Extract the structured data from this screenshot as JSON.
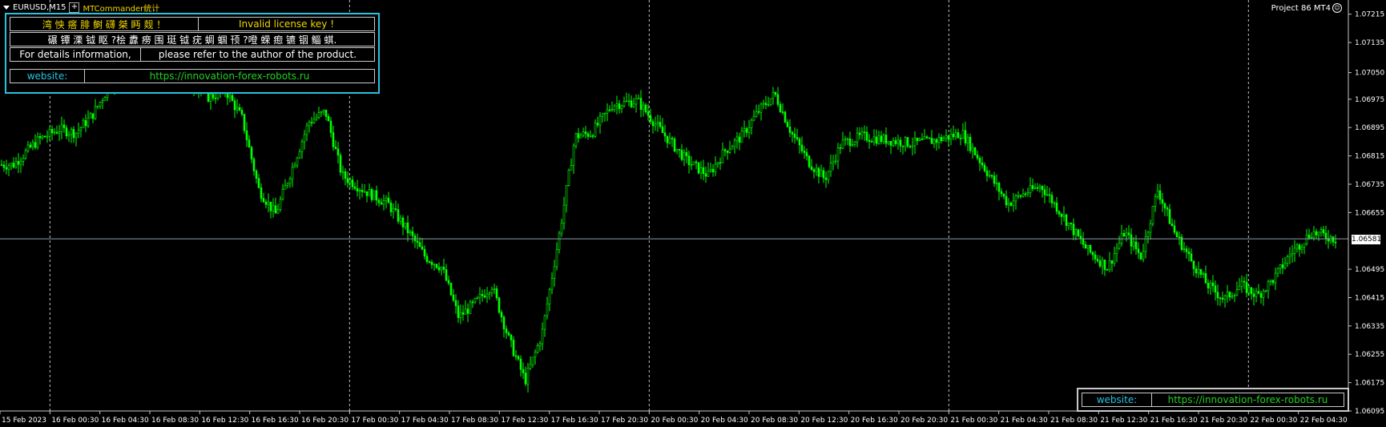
{
  "symbol": "EURUSD,M15",
  "plus_label": "+",
  "indicator_name": "MTCommander统计",
  "project_label": "Project 86 MT4",
  "smiley_icon": "smiley-icon",
  "panel": {
    "row1": {
      "garbled": "湾 怏 瘩       腓 鲥 礴 桀 眄       觌       ！",
      "message": "Invalid license key !"
    },
    "row2": {
      "text": "碾      镡 溧 钺 眍 ?桧 纛 痨 围 珽  钺 疣 蜩 蝈 顸  ?噔 蝾 瘛  镳 铟 鲻 蜞."
    },
    "row3": {
      "left": "For details information,",
      "right": "please refer to the author of the product."
    },
    "row4": {
      "label": "website:",
      "url": "https://innovation-forex-robots.ru"
    }
  },
  "website_box": {
    "label": "website:",
    "url": "https://innovation-forex-robots.ru"
  },
  "current_price": "1.06581",
  "colors": {
    "candle": "#00ff00",
    "grid": "#c0c0c0",
    "price_line": "#8a9aa8",
    "panel_border": "#27c2e0"
  },
  "price_axis": [
    "1.07215",
    "1.07135",
    "1.07050",
    "1.06975",
    "1.06895",
    "1.06815",
    "1.06735",
    "1.06655",
    "1.06495",
    "1.06415",
    "1.06335",
    "1.06255",
    "1.06175",
    "1.06095"
  ],
  "time_axis": [
    "15 Feb 2023",
    "16 Feb 00:30",
    "16 Feb 04:30",
    "16 Feb 08:30",
    "16 Feb 12:30",
    "16 Feb 16:30",
    "16 Feb 20:30",
    "17 Feb 00:30",
    "17 Feb 04:30",
    "17 Feb 08:30",
    "17 Feb 12:30",
    "17 Feb 16:30",
    "17 Feb 20:30",
    "20 Feb 00:30",
    "20 Feb 04:30",
    "20 Feb 08:30",
    "20 Feb 12:30",
    "20 Feb 16:30",
    "20 Feb 20:30",
    "21 Feb 00:30",
    "21 Feb 04:30",
    "21 Feb 08:30",
    "21 Feb 12:30",
    "21 Feb 16:30",
    "21 Feb 20:30",
    "22 Feb 00:30",
    "22 Feb 04:30"
  ],
  "chart_data": {
    "type": "candlestick",
    "ylim": [
      1.06095,
      1.07255
    ],
    "day_separators": [
      "16 Feb 00:30",
      "17 Feb 00:30",
      "20 Feb 00:30",
      "21 Feb 00:30",
      "22 Feb 00:30"
    ],
    "close_path": [
      [
        "15 Feb 2023",
        1.0679
      ],
      [
        "15 Feb 2023",
        1.0686
      ],
      [
        "16 Feb 00:30",
        1.0689
      ],
      [
        "16 Feb 00:30",
        1.0688
      ],
      [
        "16 Feb 00:30",
        1.0693
      ],
      [
        "16 Feb 04:30",
        1.0703
      ],
      [
        "16 Feb 04:30",
        1.0705
      ],
      [
        "16 Feb 08:30",
        1.0701
      ],
      [
        "16 Feb 08:30",
        1.0703
      ],
      [
        "16 Feb 12:30",
        1.0698
      ],
      [
        "16 Feb 12:30",
        1.07
      ],
      [
        "16 Feb 12:30",
        1.0692
      ],
      [
        "16 Feb 16:30",
        1.0672
      ],
      [
        "16 Feb 16:30",
        1.0665
      ],
      [
        "16 Feb 16:30",
        1.0678
      ],
      [
        "16 Feb 20:30",
        1.0691
      ],
      [
        "16 Feb 20:30",
        1.0694
      ],
      [
        "16 Feb 20:30",
        1.0676
      ],
      [
        "17 Feb 00:30",
        1.0672
      ],
      [
        "17 Feb 00:30",
        1.0668
      ],
      [
        "17 Feb 04:30",
        1.066
      ],
      [
        "17 Feb 04:30",
        1.0653
      ],
      [
        "17 Feb 04:30",
        1.065
      ],
      [
        "17 Feb 08:30",
        1.0636
      ],
      [
        "17 Feb 08:30",
        1.064
      ],
      [
        "17 Feb 08:30",
        1.0645
      ],
      [
        "17 Feb 12:30",
        1.063
      ],
      [
        "17 Feb 12:30",
        1.0618
      ],
      [
        "17 Feb 12:30",
        1.0631
      ],
      [
        "17 Feb 16:30",
        1.0658
      ],
      [
        "17 Feb 16:30",
        1.0687
      ],
      [
        "17 Feb 16:30",
        1.0688
      ],
      [
        "17 Feb 20:30",
        1.0696
      ],
      [
        "17 Feb 20:30",
        1.0697
      ],
      [
        "20 Feb 00:30",
        1.0688
      ],
      [
        "20 Feb 00:30",
        1.068
      ],
      [
        "20 Feb 04:30",
        1.0676
      ],
      [
        "20 Feb 04:30",
        1.0683
      ],
      [
        "20 Feb 04:30",
        1.0687
      ],
      [
        "20 Feb 08:30",
        1.0694
      ],
      [
        "20 Feb 08:30",
        1.0699
      ],
      [
        "20 Feb 08:30",
        1.0688
      ],
      [
        "20 Feb 12:30",
        1.068
      ],
      [
        "20 Feb 12:30",
        1.0675
      ],
      [
        "20 Feb 12:30",
        1.0685
      ],
      [
        "20 Feb 16:30",
        1.0687
      ],
      [
        "20 Feb 16:30",
        1.0686
      ],
      [
        "20 Feb 20:30",
        1.0685
      ],
      [
        "20 Feb 20:30",
        1.0686
      ],
      [
        "21 Feb 00:30",
        1.0688
      ],
      [
        "21 Feb 00:30",
        1.0677
      ],
      [
        "21 Feb 04:30",
        1.0668
      ],
      [
        "21 Feb 04:30",
        1.0671
      ],
      [
        "21 Feb 04:30",
        1.0673
      ],
      [
        "21 Feb 08:30",
        1.0665
      ],
      [
        "21 Feb 08:30",
        1.0655
      ],
      [
        "21 Feb 12:30",
        1.065
      ],
      [
        "21 Feb 12:30",
        1.066
      ],
      [
        "21 Feb 12:30",
        1.0653
      ],
      [
        "21 Feb 16:30",
        1.0672
      ],
      [
        "21 Feb 16:30",
        1.066
      ],
      [
        "21 Feb 16:30",
        1.0652
      ],
      [
        "21 Feb 20:30",
        1.0645
      ],
      [
        "21 Feb 20:30",
        1.0641
      ],
      [
        "21 Feb 20:30",
        1.0645
      ],
      [
        "22 Feb 00:30",
        1.0642
      ],
      [
        "22 Feb 00:30",
        1.0647
      ],
      [
        "22 Feb 00:30",
        1.0654
      ],
      [
        "22 Feb 04:30",
        1.066
      ],
      [
        "22 Feb 04:30",
        1.0658
      ]
    ]
  }
}
